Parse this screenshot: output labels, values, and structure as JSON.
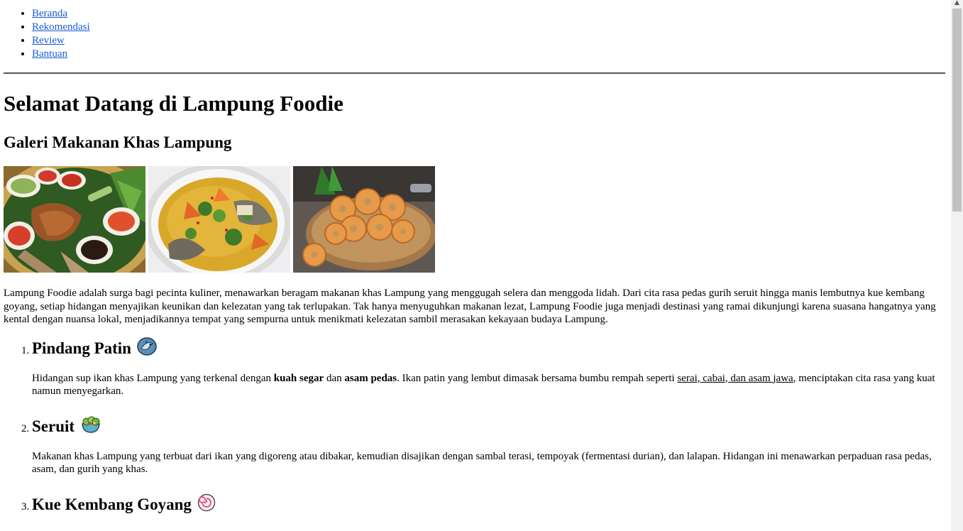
{
  "nav": {
    "items": [
      {
        "label": "Beranda"
      },
      {
        "label": "Rekomendasi"
      },
      {
        "label": "Review"
      },
      {
        "label": "Bantuan"
      }
    ]
  },
  "page_title": "Selamat Datang di Lampung Foodie",
  "gallery": {
    "title": "Galeri Makanan Khas Lampung"
  },
  "intro": "Lampung Foodie adalah surga bagi pecinta kuliner, menawarkan beragam makanan khas Lampung yang menggugah selera dan menggoda lidah. Dari cita rasa pedas gurih seruit hingga manis lembutnya kue kembang goyang, setiap hidangan menyajikan keunikan dan kelezatan yang tak terlupakan. Tak hanya menyuguhkan makanan lezat, Lampung Foodie juga menjadi destinasi yang ramai dikunjungi karena suasana hangatnya yang kental dengan nuansa lokal, menjadikannya tempat yang sempurna untuk menikmati kelezatan sambil merasakan kekayaan budaya Lampung.",
  "foods": [
    {
      "title": "Pindang Patin",
      "icon": "shark-icon",
      "desc": {
        "p1": "Hidangan sup ikan khas Lampung yang terkenal dengan ",
        "b1": "kuah segar",
        "p2": " dan ",
        "b2": "asam pedas",
        "p3": ". Ikan patin yang lembut dimasak bersama bumbu rempah seperti ",
        "u1": "serai, cabai, dan asam jawa",
        "p4": ", menciptakan cita rasa yang kuat namun menyegarkan."
      }
    },
    {
      "title": "Seruit",
      "icon": "salad-icon",
      "desc": "Makanan khas Lampung yang terbuat dari ikan yang digoreng atau dibakar, kemudian disajikan dengan sambal terasi, tempoyak (fermentasi durian), dan lalapan. Hidangan ini menawarkan perpaduan rasa pedas, asam, dan gurih yang khas."
    },
    {
      "title": "Kue Kembang Goyang",
      "icon": "fish-cake-icon"
    }
  ]
}
